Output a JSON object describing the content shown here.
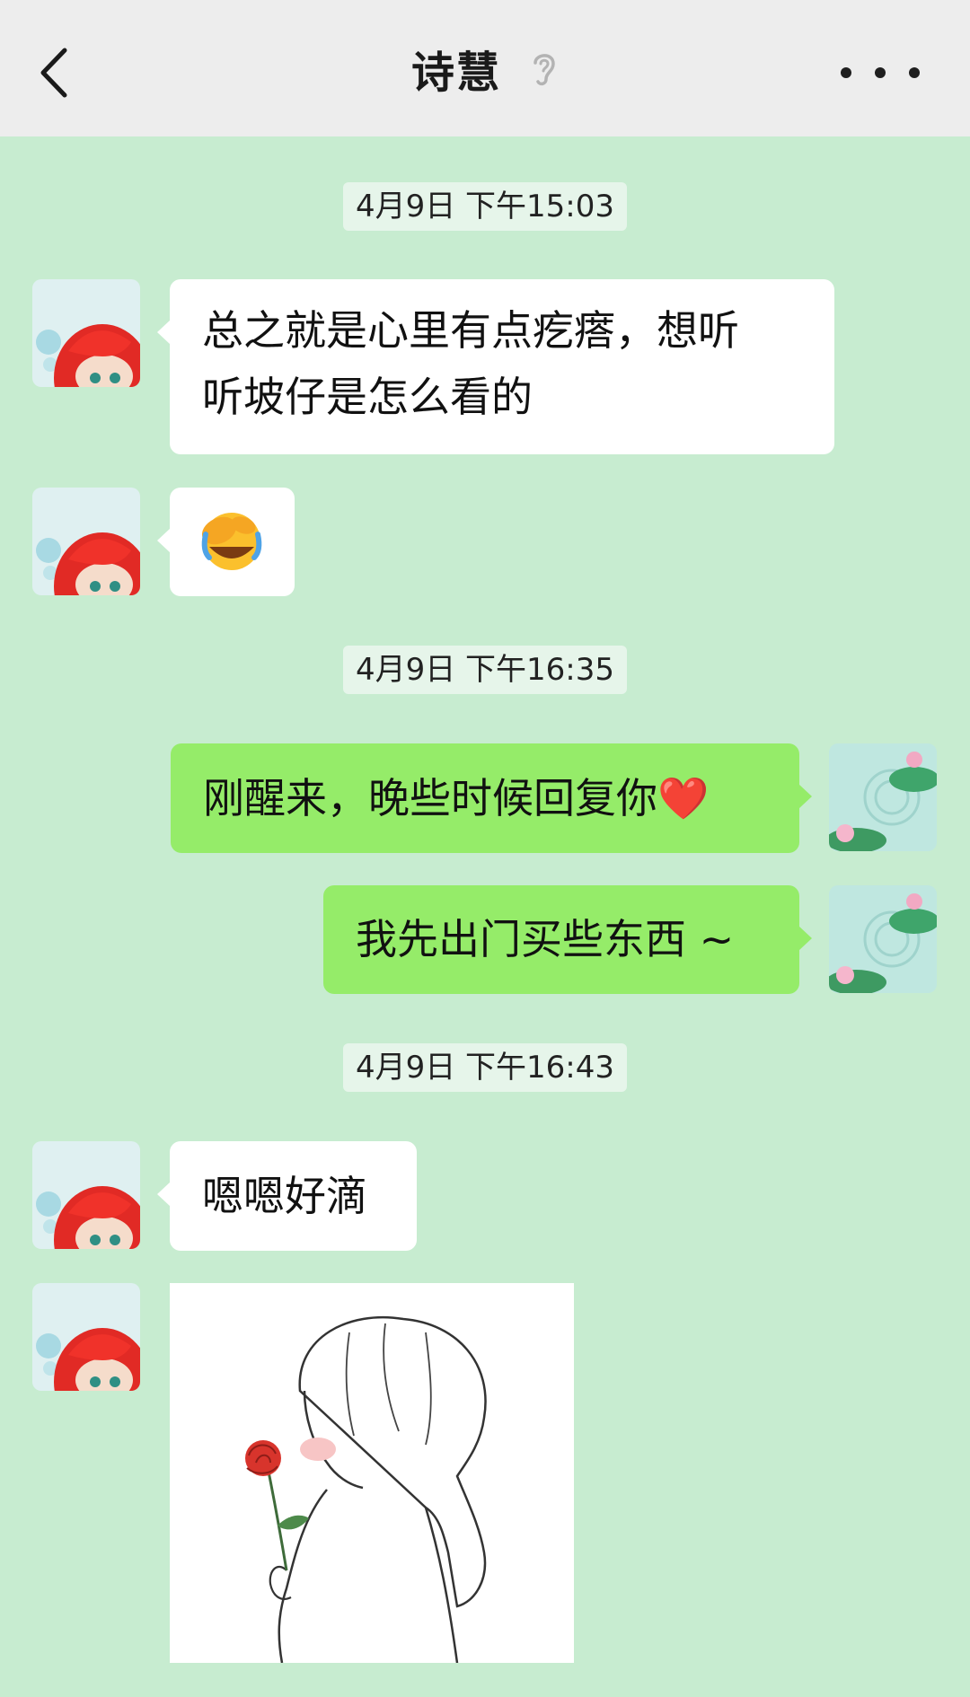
{
  "header": {
    "title": "诗慧",
    "back_icon": "chevron-left-icon",
    "mute_icon": "ear-icon",
    "more_icon": "more-icon"
  },
  "colors": {
    "chat_bg": "#c7ecd0",
    "header_bg": "#ededed",
    "incoming_bubble": "#ffffff",
    "outgoing_bubble": "#95ec69",
    "timestamp_bg": "#e6f5ea"
  },
  "messages": {
    "time_1": "4月9日 下午15:03",
    "msg_1": "总之就是心里有点疙瘩，想听\n听坡仔是怎么看的",
    "emoji_2": "🤦",
    "time_2": "4月9日 下午16:35",
    "msg_3": "刚醒来，晚些时候回复你❤️",
    "msg_4": "我先出门买些东西 ~",
    "time_3": "4月9日 下午16:43",
    "msg_5": "嗯嗯好滴",
    "sticker_6": "rose-sticker"
  }
}
